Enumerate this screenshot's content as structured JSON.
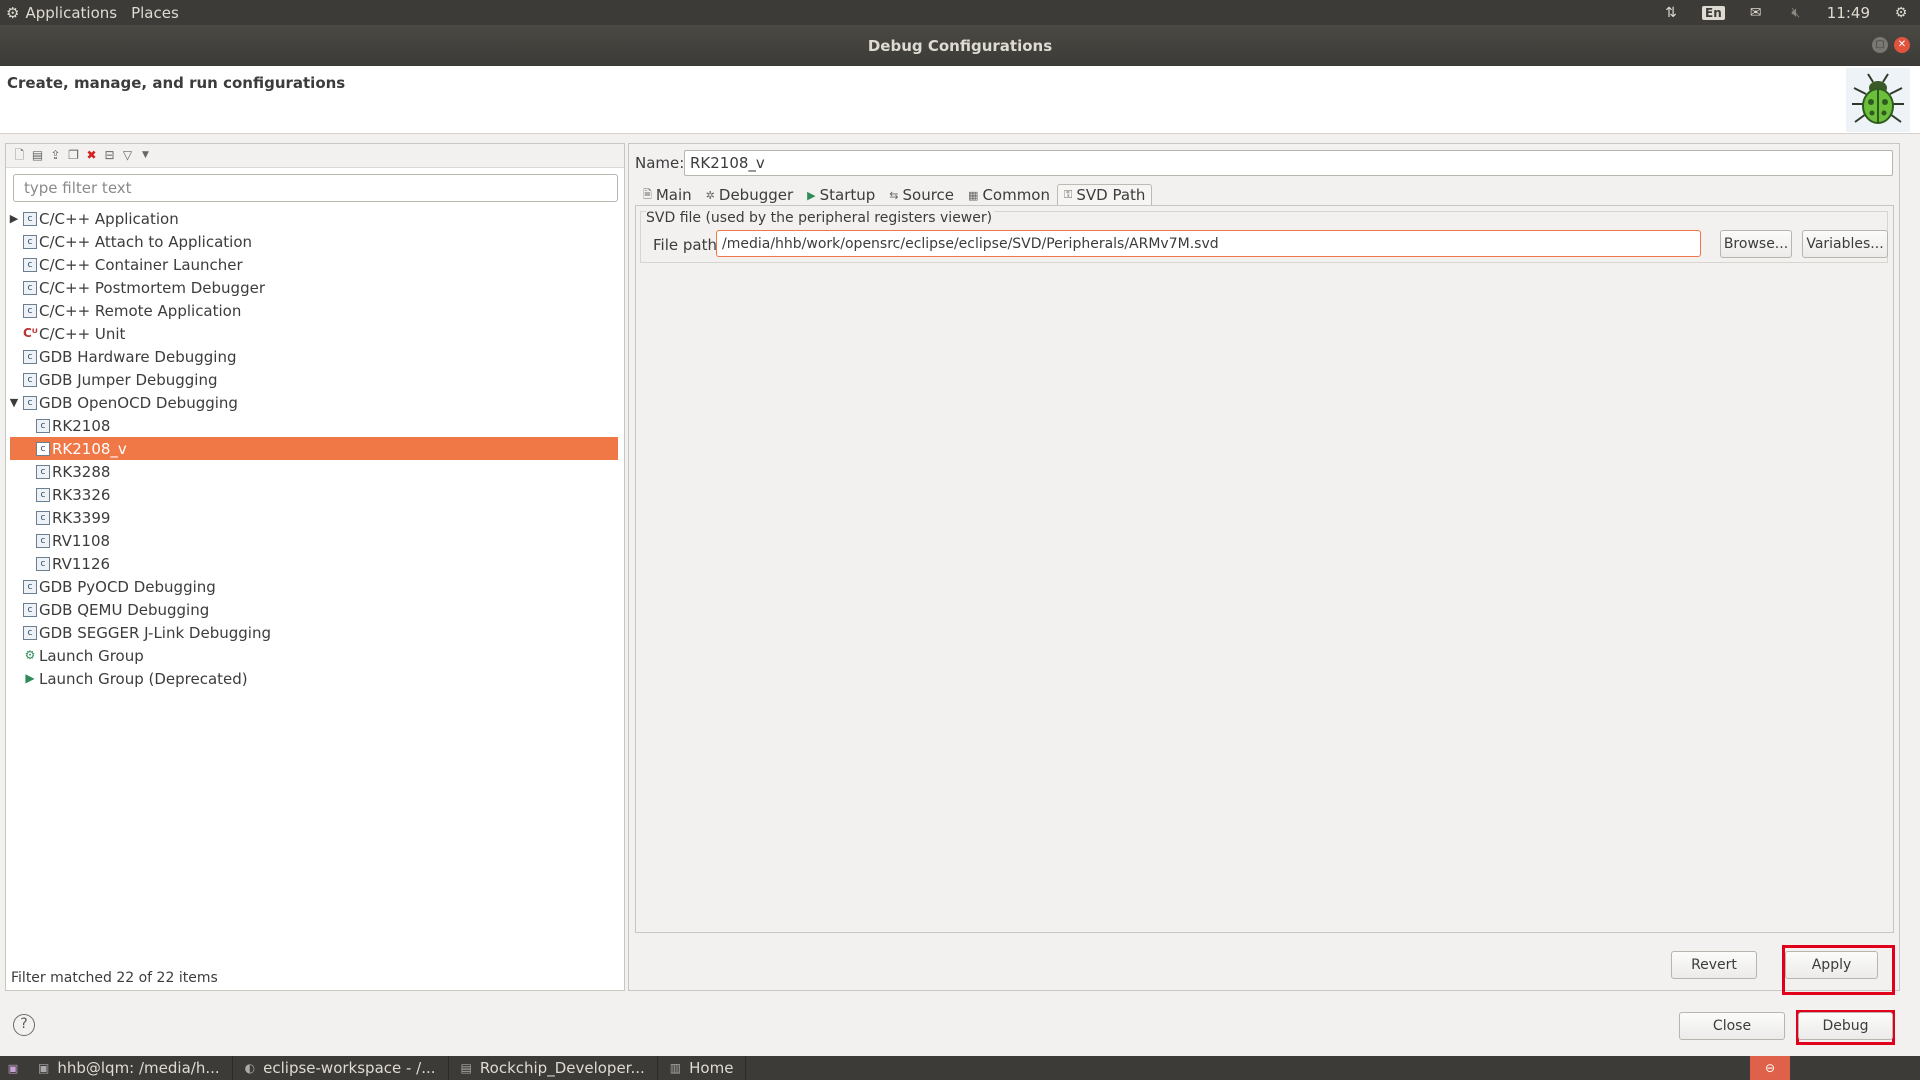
{
  "top_panel": {
    "menu": [
      "Applications",
      "Places"
    ],
    "keyboard_layout": "En",
    "clock": "11:49"
  },
  "window": {
    "title": "Debug Configurations",
    "subtitle": "Create, manage, and run configurations"
  },
  "left": {
    "filter_placeholder": "type filter text",
    "tree": [
      {
        "label": "C/C++ Application",
        "level": 0,
        "arrow": "collapsed",
        "icon": "c-config-icon"
      },
      {
        "label": "C/C++ Attach to Application",
        "level": 0,
        "arrow": "",
        "icon": "c-config-icon"
      },
      {
        "label": "C/C++ Container Launcher",
        "level": 0,
        "arrow": "",
        "icon": "c-config-icon"
      },
      {
        "label": "C/C++ Postmortem Debugger",
        "level": 0,
        "arrow": "",
        "icon": "c-config-icon"
      },
      {
        "label": "C/C++ Remote Application",
        "level": 0,
        "arrow": "",
        "icon": "c-config-icon"
      },
      {
        "label": "C/C++ Unit",
        "level": 0,
        "arrow": "",
        "icon": "cunit-icon"
      },
      {
        "label": "GDB Hardware Debugging",
        "level": 0,
        "arrow": "",
        "icon": "c-config-icon"
      },
      {
        "label": "GDB Jumper Debugging",
        "level": 0,
        "arrow": "",
        "icon": "c-config-icon"
      },
      {
        "label": "GDB OpenOCD Debugging",
        "level": 0,
        "arrow": "expanded",
        "icon": "c-config-icon"
      },
      {
        "label": "RK2108",
        "level": 1,
        "arrow": "",
        "icon": "c-config-icon"
      },
      {
        "label": "RK2108_v",
        "level": 1,
        "arrow": "",
        "icon": "c-config-icon",
        "selected": true
      },
      {
        "label": "RK3288",
        "level": 1,
        "arrow": "",
        "icon": "c-config-icon"
      },
      {
        "label": "RK3326",
        "level": 1,
        "arrow": "",
        "icon": "c-config-icon"
      },
      {
        "label": "RK3399",
        "level": 1,
        "arrow": "",
        "icon": "c-config-icon"
      },
      {
        "label": "RV1108",
        "level": 1,
        "arrow": "",
        "icon": "c-config-icon"
      },
      {
        "label": "RV1126",
        "level": 1,
        "arrow": "",
        "icon": "c-config-icon"
      },
      {
        "label": "GDB PyOCD Debugging",
        "level": 0,
        "arrow": "",
        "icon": "c-config-icon"
      },
      {
        "label": "GDB QEMU Debugging",
        "level": 0,
        "arrow": "",
        "icon": "c-config-icon"
      },
      {
        "label": "GDB SEGGER J-Link Debugging",
        "level": 0,
        "arrow": "",
        "icon": "c-config-icon"
      },
      {
        "label": "Launch Group",
        "level": 0,
        "arrow": "",
        "icon": "launch-group-icon"
      },
      {
        "label": "Launch Group (Deprecated)",
        "level": 0,
        "arrow": "",
        "icon": "launch-icon"
      }
    ],
    "status": "Filter matched 22 of 22 items"
  },
  "right": {
    "name_label": "Name:",
    "name_value": "RK2108_v",
    "tabs": [
      {
        "label": "Main",
        "icon": "main-tab-icon",
        "active": false
      },
      {
        "label": "Debugger",
        "icon": "debugger-tab-icon",
        "active": false
      },
      {
        "label": "Startup",
        "icon": "startup-tab-icon",
        "active": false
      },
      {
        "label": "Source",
        "icon": "source-tab-icon",
        "active": false
      },
      {
        "label": "Common",
        "icon": "common-tab-icon",
        "active": false
      },
      {
        "label": "SVD Path",
        "icon": "svd-tab-icon",
        "active": true
      }
    ],
    "svd_group_label": "SVD file (used by the peripheral registers viewer)",
    "file_path_label": "File path:",
    "file_path_value": "/media/hhb/work/opensrc/eclipse/eclipse/SVD/Peripherals/ARMv7M.svd",
    "browse_label": "Browse...",
    "variables_label": "Variables...",
    "revert_label": "Revert",
    "apply_label": "Apply"
  },
  "bottom": {
    "close_label": "Close",
    "debug_label": "Debug"
  },
  "taskbar": {
    "items": [
      {
        "label": "hhb@lqm: /media/h...",
        "icon": "terminal-icon"
      },
      {
        "label": "eclipse-workspace - /...",
        "icon": "eclipse-icon"
      },
      {
        "label": "Rockchip_Developer...",
        "icon": "document-icon"
      },
      {
        "label": "Home",
        "icon": "folder-icon"
      }
    ]
  },
  "colors": {
    "selection": "#f07746",
    "highlight_box": "#e0001b",
    "panel_dark": "#3c3b37"
  }
}
